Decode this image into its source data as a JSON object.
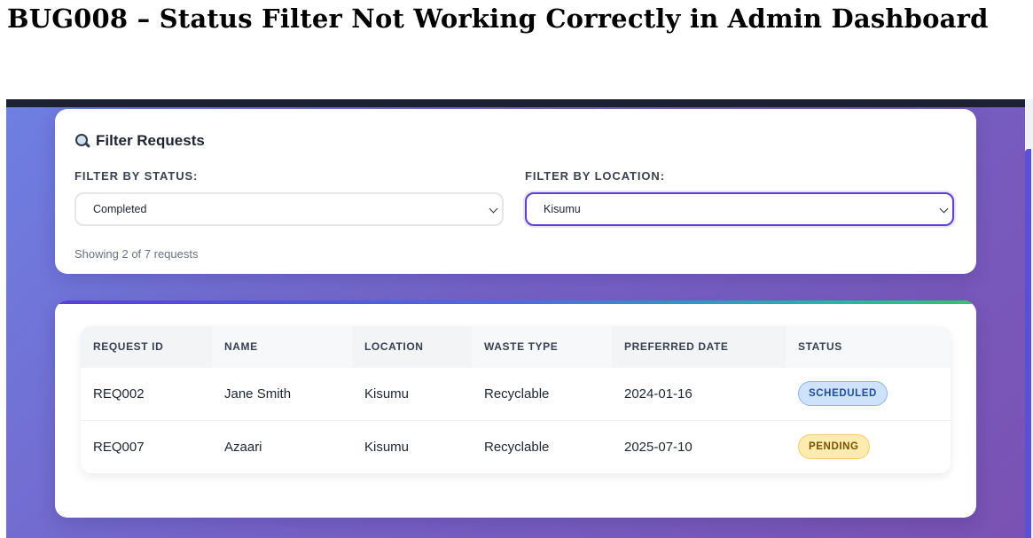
{
  "document": {
    "title": "BUG008 – Status Filter Not Working Correctly in Admin Dashboard"
  },
  "filter_panel": {
    "heading": "Filter Requests",
    "heading_icon": "search-icon",
    "status_filter": {
      "label": "FILTER BY STATUS:",
      "value": "Completed"
    },
    "location_filter": {
      "label": "FILTER BY LOCATION:",
      "value": "Kisumu",
      "focused": true
    },
    "result_count_text": "Showing 2 of 7 requests"
  },
  "requests_table": {
    "columns": [
      "REQUEST ID",
      "NAME",
      "LOCATION",
      "WASTE TYPE",
      "PREFERRED DATE",
      "STATUS"
    ],
    "rows": [
      {
        "request_id": "REQ002",
        "name": "Jane Smith",
        "location": "Kisumu",
        "waste_type": "Recyclable",
        "preferred_date": "2024-01-16",
        "status": "SCHEDULED"
      },
      {
        "request_id": "REQ007",
        "name": "Azaari",
        "location": "Kisumu",
        "waste_type": "Recyclable",
        "preferred_date": "2025-07-10",
        "status": "PENDING"
      }
    ]
  },
  "colors": {
    "accent": "#5b3fd6",
    "background_gradient": [
      "#6e7fe2",
      "#7a52b3"
    ],
    "status_scheduled": "#cfe2fb",
    "status_pending": "#fdebb0"
  }
}
